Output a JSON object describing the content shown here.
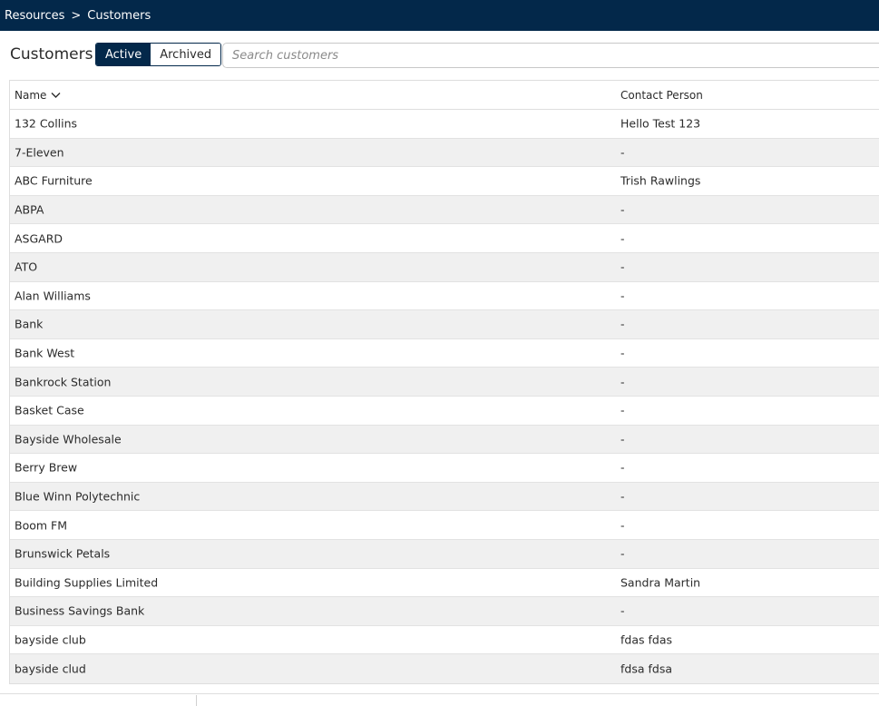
{
  "breadcrumb": {
    "parent": "Resources",
    "separator": ">",
    "current": "Customers"
  },
  "page_title": "Customers",
  "filter": {
    "active_label": "Active",
    "archived_label": "Archived",
    "selected": "Active"
  },
  "search": {
    "placeholder": "Search customers",
    "value": ""
  },
  "table": {
    "columns": {
      "name": "Name",
      "contact": "Contact Person"
    },
    "sort": {
      "column": "Name",
      "direction": "descending-indicator"
    },
    "rows": [
      {
        "name": "132 Collins",
        "contact": "Hello Test 123"
      },
      {
        "name": "7-Eleven",
        "contact": "-"
      },
      {
        "name": "ABC Furniture",
        "contact": "Trish Rawlings"
      },
      {
        "name": "ABPA",
        "contact": "-"
      },
      {
        "name": "ASGARD",
        "contact": "-"
      },
      {
        "name": "ATO",
        "contact": "-"
      },
      {
        "name": "Alan Williams",
        "contact": "-"
      },
      {
        "name": "Bank",
        "contact": "-"
      },
      {
        "name": "Bank West",
        "contact": "-"
      },
      {
        "name": "Bankrock Station",
        "contact": "-"
      },
      {
        "name": "Basket Case",
        "contact": "-"
      },
      {
        "name": "Bayside Wholesale",
        "contact": "-"
      },
      {
        "name": "Berry Brew",
        "contact": "-"
      },
      {
        "name": "Blue Winn Polytechnic",
        "contact": "-"
      },
      {
        "name": "Boom FM",
        "contact": "-"
      },
      {
        "name": "Brunswick Petals",
        "contact": "-"
      },
      {
        "name": "Building Supplies Limited",
        "contact": "Sandra Martin"
      },
      {
        "name": "Business Savings Bank",
        "contact": "-"
      },
      {
        "name": "bayside club",
        "contact": "fdas fdas"
      },
      {
        "name": "bayside clud",
        "contact": "fdsa fdsa"
      }
    ]
  },
  "colors": {
    "header_bg": "#03284a",
    "row_alt_bg": "#f0f0f0",
    "border": "#dedede"
  },
  "icons": {
    "sort": "chevron-down-icon"
  }
}
